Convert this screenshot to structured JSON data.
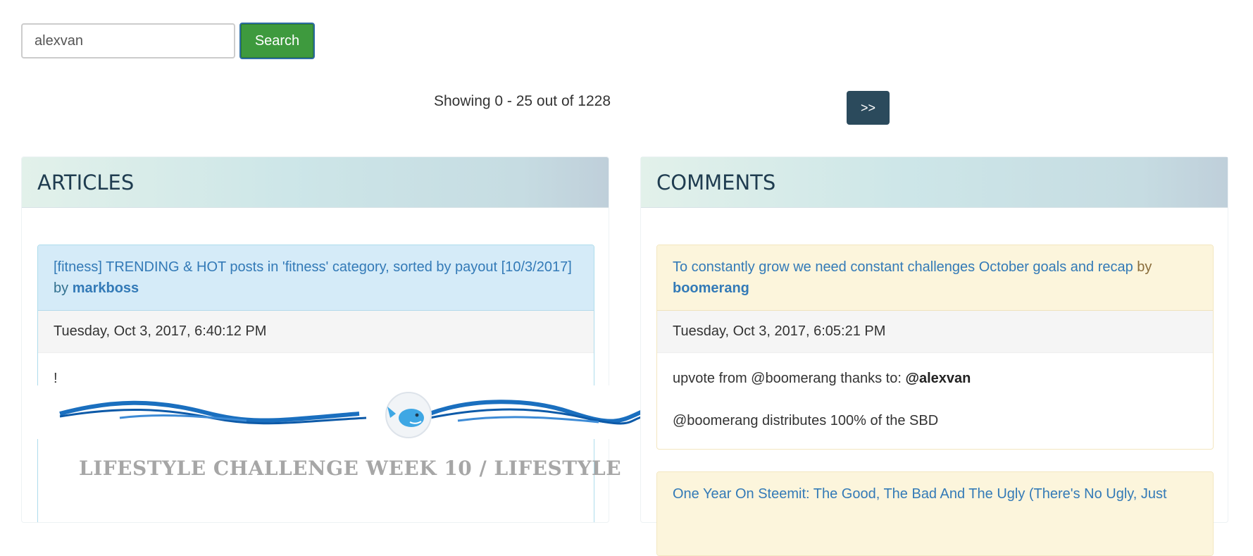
{
  "search": {
    "value": "alexvan",
    "button_label": "Search"
  },
  "pager": {
    "text": "Showing 0 - 25 out of 1228",
    "next_label": ">>"
  },
  "articles": {
    "heading": "ARTICLES",
    "items": [
      {
        "title": "[fitness] TRENDING & HOT posts in 'fitness' category, sorted by payout [10/3/2017]",
        "by": "by",
        "author": "markboss",
        "date": "Tuesday, Oct 3, 2017, 6:40:12 PM",
        "body_text": "!",
        "image_caption": "LIFESTYLE CHALLENGE WEEK 10 / LIFESTYLE"
      }
    ]
  },
  "comments": {
    "heading": "COMMENTS",
    "items": [
      {
        "title": "To constantly grow we need constant challenges October goals and recap",
        "by": "by",
        "author": "boomerang",
        "date": "Tuesday, Oct 3, 2017, 6:05:21 PM",
        "line1_prefix": "upvote from @boomerang thanks to: ",
        "line1_mention": "@alexvan",
        "line2": "@boomerang distributes 100% of the SBD"
      },
      {
        "title": "One Year On Steemit: The Good, The Bad And The Ugly (There's No Ugly, Just"
      }
    ]
  },
  "colors": {
    "search_button": "#3e9a3e",
    "next_button": "#2b4a5c",
    "link": "#337ab7",
    "info_header": "#d5ebf8",
    "warning_header": "#fcf5dc"
  },
  "icons": {
    "banner_mascot": "whale-icon"
  }
}
